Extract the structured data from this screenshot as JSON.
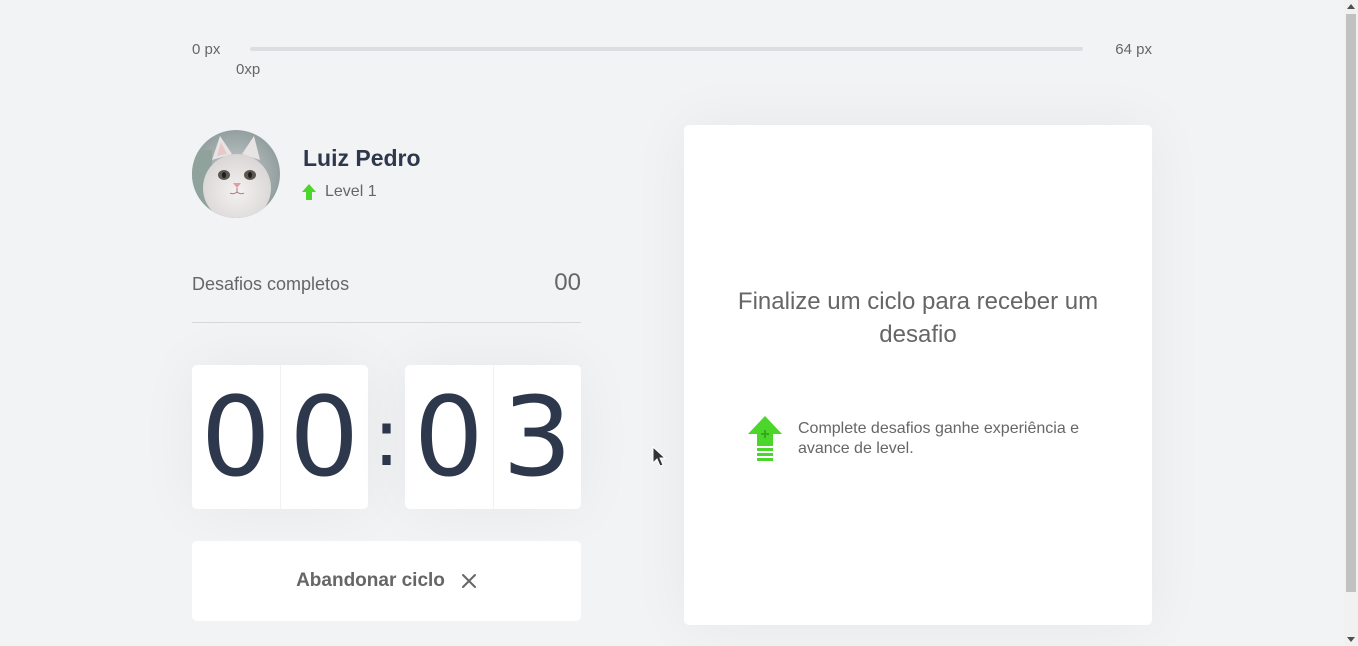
{
  "experience_bar": {
    "min_label": "0 px",
    "max_label": "64 px",
    "current_label": "0xp",
    "progress_fraction": 0
  },
  "profile": {
    "name": "Luiz Pedro",
    "level_label": "Level 1",
    "avatar_icon": "cat-photo-avatar",
    "level_icon": "level-up-arrow-icon"
  },
  "completed_challenges": {
    "label": "Desafios completos",
    "count": "00"
  },
  "countdown": {
    "minute_left": "0",
    "minute_right": "0",
    "separator": ":",
    "second_left": "0",
    "second_right": "3"
  },
  "abandon_button": {
    "label": "Abandonar ciclo",
    "icon": "close-icon"
  },
  "challenge_box": {
    "title": "Finalize um ciclo para receber um desafio",
    "hint": "Complete desafios ganhe experiência e avance de level.",
    "hint_icon": "level-up-icon"
  },
  "colors": {
    "accent_green": "#4cd62b",
    "text": "#666666",
    "title": "#2e384d",
    "background": "#f2f3f5"
  }
}
